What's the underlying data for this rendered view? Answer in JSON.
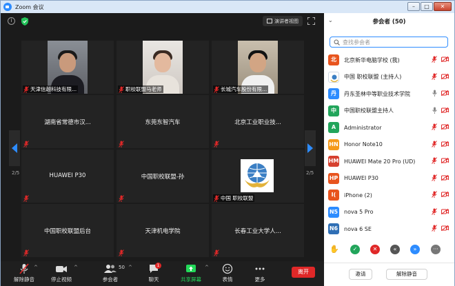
{
  "window": {
    "title": "Zoom 会议"
  },
  "view": {
    "speaker_view_label": "演讲者视图",
    "page_indicator": "2/5"
  },
  "tiles": [
    {
      "name": "天津信越科技有限...",
      "has_video": true,
      "muted": true
    },
    {
      "name": "职校联盟马老师",
      "has_video": true,
      "muted": true
    },
    {
      "name": "长城汽车股份有限...",
      "has_video": true,
      "muted": true
    },
    {
      "name": "湖南省常德市汉...",
      "has_video": false,
      "muted": true
    },
    {
      "name": "东莞东智汽车",
      "has_video": false,
      "muted": true
    },
    {
      "name": "北京工业职业技...",
      "has_video": false,
      "muted": true
    },
    {
      "name": "HUAWEI P30",
      "has_video": false,
      "muted": true
    },
    {
      "name": "中国职校联盟-孙",
      "has_video": false,
      "muted": true
    },
    {
      "name": "中国 职校联盟",
      "has_video": true,
      "muted": true
    },
    {
      "name": "中国职校联盟后台",
      "has_video": false,
      "muted": true
    },
    {
      "name": "天津机电学院",
      "has_video": false,
      "muted": true
    },
    {
      "name": "长春工业大学人...",
      "has_video": false,
      "muted": true
    }
  ],
  "toolbar": {
    "unmute_label": "解除静音",
    "stop_video_label": "停止视频",
    "participants_label": "参会者",
    "participants_count": "50",
    "chat_label": "聊天",
    "chat_badge": "1",
    "share_label": "共享屏幕",
    "reactions_label": "表情",
    "more_label": "更多",
    "leave_label": "离开"
  },
  "panel": {
    "title": "参会者 (50)",
    "search_placeholder": "查找参会者",
    "participants": [
      {
        "avatar": "北",
        "avatar_color": "#e8541e",
        "name": "北京新华电脑学校 (我)",
        "mic": "off",
        "video": "off"
      },
      {
        "avatar": "",
        "avatar_color": "#2f6fb5",
        "name": "中国 职校联盟 (主持人)",
        "mic": "off",
        "video": "off"
      },
      {
        "avatar": "丹",
        "avatar_color": "#2d8cff",
        "name": "丹东圣林中等职业技术学院",
        "mic": "on",
        "video": "off"
      },
      {
        "avatar": "中",
        "avatar_color": "#22a55b",
        "name": "中国职校联盟主持人",
        "mic": "on",
        "video": "off"
      },
      {
        "avatar": "A",
        "avatar_color": "#22a55b",
        "name": "Administrator",
        "mic": "off",
        "video": "off"
      },
      {
        "avatar": "HN",
        "avatar_color": "#f59a1b",
        "name": "Honor Note10",
        "mic": "off",
        "video": "off"
      },
      {
        "avatar": "HM",
        "avatar_color": "#d64130",
        "name": "HUAWEI Mate 20 Pro (UD)",
        "mic": "off",
        "video": "off"
      },
      {
        "avatar": "HP",
        "avatar_color": "#e8541e",
        "name": "HUAWEI P30",
        "mic": "off",
        "video": "off"
      },
      {
        "avatar": "I(",
        "avatar_color": "#e8541e",
        "name": "iPhone (2)",
        "mic": "off",
        "video": "off"
      },
      {
        "avatar": "N5",
        "avatar_color": "#2d8cff",
        "name": "nova 5 Pro",
        "mic": "off",
        "video": "off"
      },
      {
        "avatar": "N6",
        "avatar_color": "#2f6fb5",
        "name": "nova 6 SE",
        "mic": "off",
        "video": "off"
      }
    ],
    "invite_label": "邀请",
    "unmute_all_label": "解除静音"
  },
  "colors": {
    "accent": "#2d8cff",
    "danger": "#e02828",
    "share": "#23d959"
  }
}
